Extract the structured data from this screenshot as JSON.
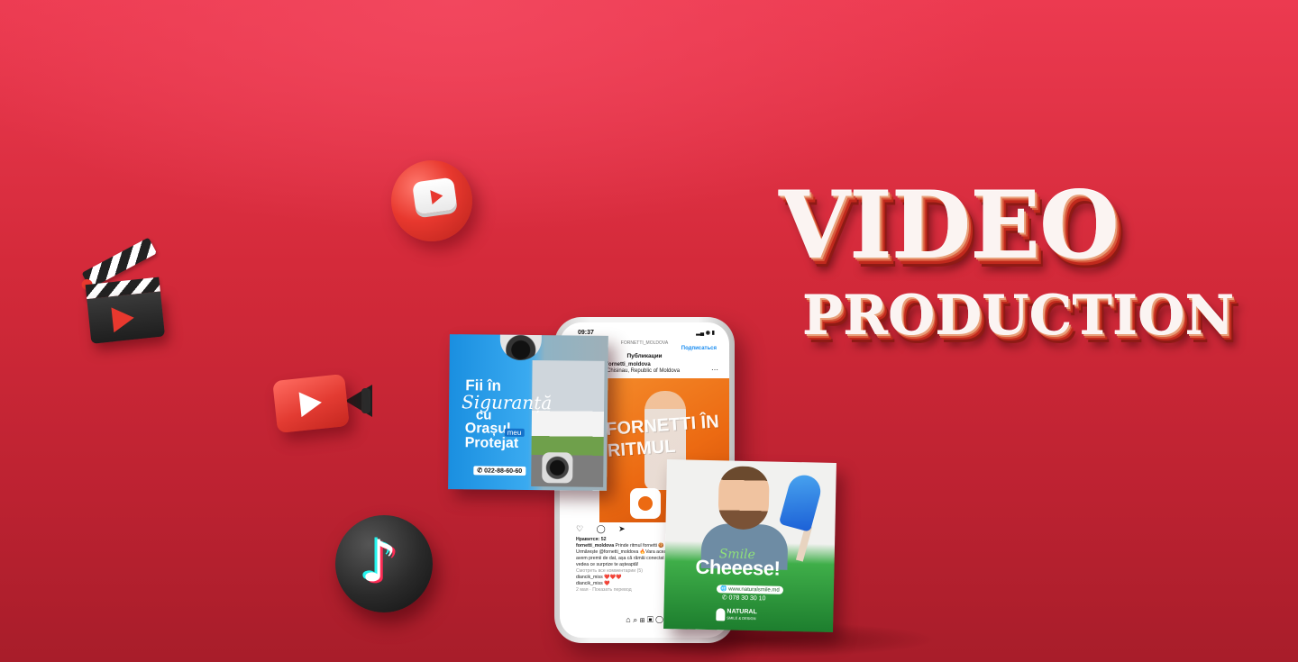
{
  "hero": {
    "title_line1": "VIDEO",
    "title_line2": "PRODUCTION",
    "colors": {
      "background": "#d42a3a",
      "title": "#fbf4f2",
      "title_shadow": "#c0291c"
    }
  },
  "floating_icons": [
    "youtube-ball-icon",
    "clapperboard-icon",
    "video-camera-icon",
    "tiktok-icon"
  ],
  "phone": {
    "time": "09:37",
    "indicators": "▂▄ ◉ ▮",
    "header_user": "FORNETTI_MOLDOVA",
    "header_title": "Публикации",
    "follow_label": "Подписаться",
    "account_name": "fornetti_moldova",
    "account_location": "Chisinau, Republic of Moldova",
    "post_text": "FORNETTI ÎN RITMUL",
    "actions": "♡ ◯ ➤",
    "likes": "Нравится: 52",
    "caption_user": "fornetti_moldova",
    "caption_text": "Prinde ritmul fornetti 🍪 👋Urmărește @fornetti_moldova 🔥Vara aceasta avem premii de dat, așa că rămâi conectat și vei vedea ce surprize te așteaptă!",
    "view_comments": "Смотреть все комментарии (5)",
    "comment1": "diancik_miss ❤️❤️❤️",
    "comment2": "diancik_miss ❤️",
    "time_ago": "2 мая · Показать перевод",
    "nav_icons": "⌂ ⌕ ⊞ ▣ ◯"
  },
  "card_left": {
    "line1": "Fii în",
    "line2": "Siguranță",
    "line3": "cu",
    "line4": "Orașul",
    "meu": "meu",
    "line5": "Protejat",
    "phone": "✆ 022-88-60-60"
  },
  "card_right": {
    "smile": "Smile",
    "headline": "Cheeese!",
    "website": "🌐 www.naturalsmile.md",
    "phone": "✆ 078 30 30 10",
    "brand": "NATURAL",
    "brand_sub": "SMILE & DESIGN"
  }
}
